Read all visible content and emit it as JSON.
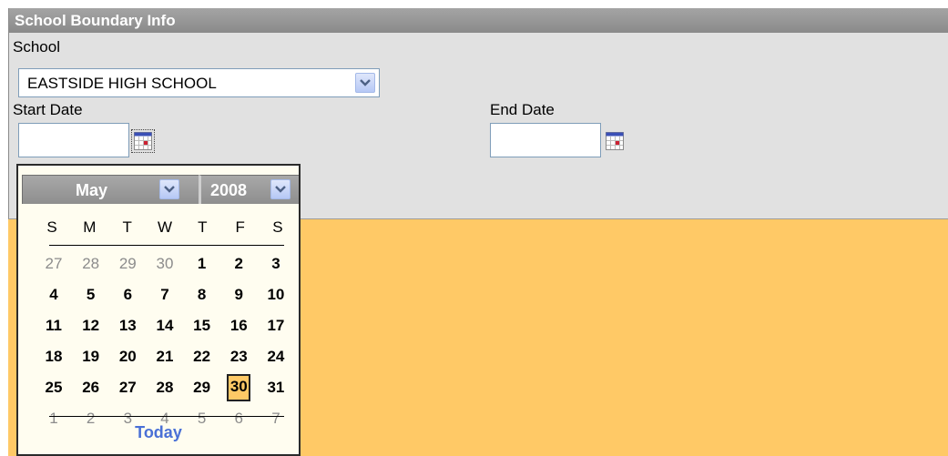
{
  "panel": {
    "title": "School Boundary Info",
    "school_label": "School",
    "school_value": "EASTSIDE HIGH SCHOOL",
    "start_date_label": "Start Date",
    "start_date_value": "",
    "end_date_label": "End Date",
    "end_date_value": ""
  },
  "calendar": {
    "month": "May",
    "year": "2008",
    "weekdays": [
      "S",
      "M",
      "T",
      "W",
      "T",
      "F",
      "S"
    ],
    "weeks": [
      [
        {
          "d": "27",
          "other": true
        },
        {
          "d": "28",
          "other": true
        },
        {
          "d": "29",
          "other": true
        },
        {
          "d": "30",
          "other": true
        },
        {
          "d": "1"
        },
        {
          "d": "2"
        },
        {
          "d": "3"
        }
      ],
      [
        {
          "d": "4"
        },
        {
          "d": "5"
        },
        {
          "d": "6"
        },
        {
          "d": "7"
        },
        {
          "d": "8"
        },
        {
          "d": "9"
        },
        {
          "d": "10"
        }
      ],
      [
        {
          "d": "11"
        },
        {
          "d": "12"
        },
        {
          "d": "13"
        },
        {
          "d": "14"
        },
        {
          "d": "15"
        },
        {
          "d": "16"
        },
        {
          "d": "17"
        }
      ],
      [
        {
          "d": "18"
        },
        {
          "d": "19"
        },
        {
          "d": "20"
        },
        {
          "d": "21"
        },
        {
          "d": "22"
        },
        {
          "d": "23"
        },
        {
          "d": "24"
        }
      ],
      [
        {
          "d": "25"
        },
        {
          "d": "26"
        },
        {
          "d": "27"
        },
        {
          "d": "28"
        },
        {
          "d": "29"
        },
        {
          "d": "30",
          "selected": true
        },
        {
          "d": "31"
        }
      ],
      [
        {
          "d": "1",
          "other": true
        },
        {
          "d": "2",
          "other": true
        },
        {
          "d": "3",
          "other": true
        },
        {
          "d": "4",
          "other": true
        },
        {
          "d": "5",
          "other": true
        },
        {
          "d": "6",
          "other": true
        },
        {
          "d": "7",
          "other": true
        }
      ]
    ],
    "today_label": "Today"
  },
  "icons": {
    "dropdown": "chevron-down-icon",
    "calendar": "calendar-icon"
  },
  "colors": {
    "panel_background": "#e1e1e1",
    "title_bar": "#8a8a8a",
    "page_background": "#ffc966",
    "calendar_background": "#fffdf0",
    "selected_day": "#ffc966",
    "today_link": "#4a70d6"
  }
}
